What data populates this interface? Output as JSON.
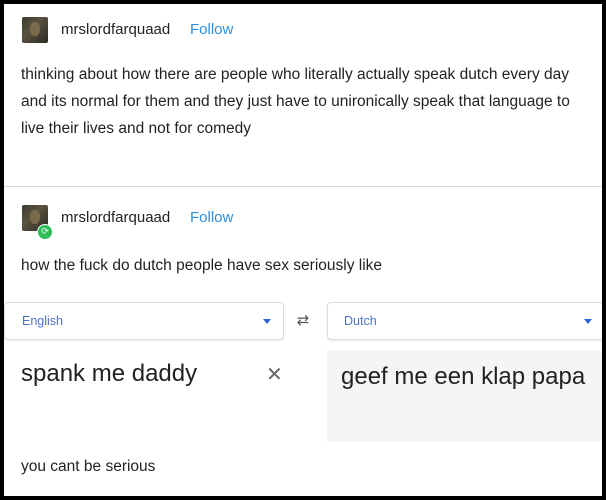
{
  "posts": [
    {
      "username": "mrslordfarquaad",
      "follow_label": "Follow",
      "text": "thinking about how there are people who literally actually speak dutch every day and its normal for them and they just have to unironically speak that language to live their lives and not for comedy"
    },
    {
      "username": "mrslordfarquaad",
      "follow_label": "Follow",
      "text": "how the fuck do dutch people have sex seriously like",
      "reblog_badge_icon": "reblog-icon"
    }
  ],
  "translator": {
    "source_language": "English",
    "target_language": "Dutch",
    "swap_icon": "swap-arrows-icon",
    "source_text": "spank me daddy",
    "clear_icon": "close-icon",
    "translated_text": "geef me een klap papa"
  },
  "footer_text": "you cant be serious",
  "colors": {
    "follow": "#2f8fd8",
    "language": "#4d72c4",
    "badge": "#2ebd59"
  }
}
